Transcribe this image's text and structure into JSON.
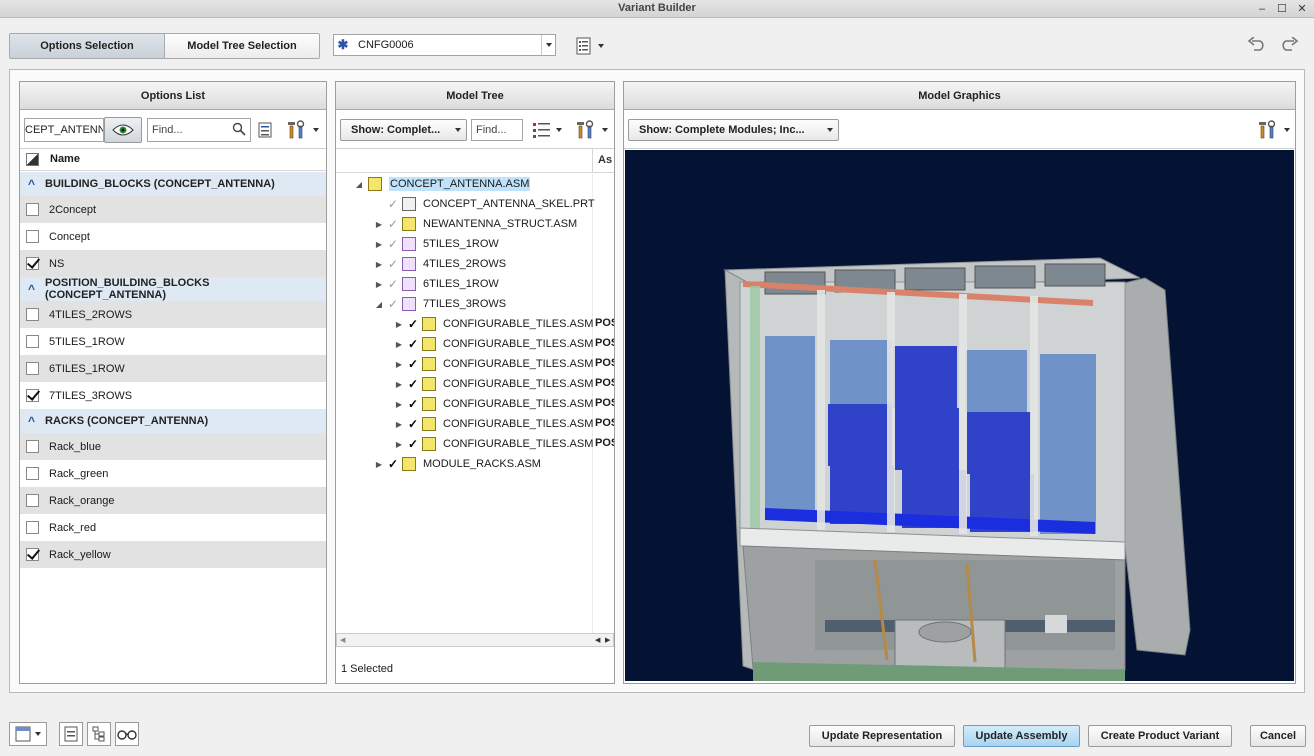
{
  "window": {
    "title": "Variant Builder",
    "minimize_glyph": "–",
    "maximize_glyph": "☐",
    "close_glyph": "✕"
  },
  "toolbar": {
    "tabs": [
      {
        "label": "Options Selection",
        "active": true
      },
      {
        "label": "Model Tree Selection",
        "active": false
      }
    ],
    "config_value": "CNFG0006",
    "undo_icon": "undo-icon",
    "redo_icon": "redo-icon"
  },
  "options_list": {
    "header": "Options List",
    "filter_value": "CEPT_ANTENNA",
    "find_placeholder": "Find...",
    "column_name": "Name",
    "groups": [
      {
        "label": "BUILDING_BLOCKS (CONCEPT_ANTENNA)",
        "items": [
          {
            "label": "2Concept",
            "checked": false
          },
          {
            "label": "Concept",
            "checked": false
          },
          {
            "label": "NS",
            "checked": true
          }
        ]
      },
      {
        "label": "POSITION_BUILDING_BLOCKS (CONCEPT_ANTENNA)",
        "items": [
          {
            "label": "4TILES_2ROWS",
            "checked": false
          },
          {
            "label": "5TILES_1ROW",
            "checked": false
          },
          {
            "label": "6TILES_1ROW",
            "checked": false
          },
          {
            "label": "7TILES_3ROWS",
            "checked": true
          }
        ]
      },
      {
        "label": "RACKS (CONCEPT_ANTENNA)",
        "items": [
          {
            "label": "Rack_blue",
            "checked": false
          },
          {
            "label": "Rack_green",
            "checked": false
          },
          {
            "label": "Rack_orange",
            "checked": false
          },
          {
            "label": "Rack_red",
            "checked": false
          },
          {
            "label": "Rack_yellow",
            "checked": true
          }
        ]
      }
    ]
  },
  "model_tree": {
    "header": "Model Tree",
    "show_label": "Show: Complet...",
    "find_placeholder": "Find...",
    "column_header": "As",
    "rows": [
      {
        "label": "CONCEPT_ANTENNA.ASM",
        "indent": 0,
        "expander": "expanded",
        "check": "",
        "icon": "asm",
        "selected": true,
        "extra": ""
      },
      {
        "label": "CONCEPT_ANTENNA_SKEL.PRT",
        "indent": 1,
        "expander": "",
        "check": "✓",
        "check_style": "grey",
        "icon": "skel",
        "extra": ""
      },
      {
        "label": "NEWANTENNA_STRUCT.ASM",
        "indent": 1,
        "expander": "collapsed",
        "check": "✓",
        "check_style": "grey",
        "icon": "asm",
        "extra": ""
      },
      {
        "label": "5TILES_1ROW",
        "indent": 1,
        "expander": "collapsed",
        "check": "✓",
        "check_style": "grey",
        "icon": "mod",
        "extra": ""
      },
      {
        "label": "4TILES_2ROWS",
        "indent": 1,
        "expander": "collapsed",
        "check": "✓",
        "check_style": "grey",
        "icon": "mod",
        "extra": ""
      },
      {
        "label": "6TILES_1ROW",
        "indent": 1,
        "expander": "collapsed",
        "check": "✓",
        "check_style": "grey",
        "icon": "mod",
        "extra": ""
      },
      {
        "label": "7TILES_3ROWS",
        "indent": 1,
        "expander": "expanded",
        "check": "✓",
        "check_style": "grey",
        "icon": "mod",
        "extra": ""
      },
      {
        "label": "CONFIGURABLE_TILES.ASM",
        "indent": 2,
        "expander": "collapsed",
        "check": "✓",
        "check_style": "black",
        "icon": "asm",
        "extra": "POS"
      },
      {
        "label": "CONFIGURABLE_TILES.ASM",
        "indent": 2,
        "expander": "collapsed",
        "check": "✓",
        "check_style": "black",
        "icon": "asm",
        "extra": "POS"
      },
      {
        "label": "CONFIGURABLE_TILES.ASM",
        "indent": 2,
        "expander": "collapsed",
        "check": "✓",
        "check_style": "black",
        "icon": "asm",
        "extra": "POS"
      },
      {
        "label": "CONFIGURABLE_TILES.ASM",
        "indent": 2,
        "expander": "collapsed",
        "check": "✓",
        "check_style": "black",
        "icon": "asm",
        "extra": "POS"
      },
      {
        "label": "CONFIGURABLE_TILES.ASM",
        "indent": 2,
        "expander": "collapsed",
        "check": "✓",
        "check_style": "black",
        "icon": "asm",
        "extra": "POS"
      },
      {
        "label": "CONFIGURABLE_TILES.ASM",
        "indent": 2,
        "expander": "collapsed",
        "check": "✓",
        "check_style": "black",
        "icon": "asm",
        "extra": "POS"
      },
      {
        "label": "CONFIGURABLE_TILES.ASM",
        "indent": 2,
        "expander": "collapsed",
        "check": "✓",
        "check_style": "black",
        "icon": "asm",
        "extra": "POS"
      },
      {
        "label": "MODULE_RACKS.ASM",
        "indent": 1,
        "expander": "collapsed",
        "check": "✓",
        "check_style": "black",
        "icon": "asm",
        "extra": ""
      }
    ],
    "status": "1 Selected"
  },
  "model_graphics": {
    "header": "Model Graphics",
    "show_label": "Show: Complete Modules; Inc...",
    "background_color": "#041233"
  },
  "footer": {
    "update_representation": "Update Representation",
    "update_assembly": "Update Assembly",
    "create_variant": "Create Product Variant",
    "cancel": "Cancel"
  },
  "colors": {
    "selection": "#bfe3fb",
    "group_row": "#dfe9f4",
    "primary_button": "#a8d3f2",
    "viewport": "#041233"
  }
}
